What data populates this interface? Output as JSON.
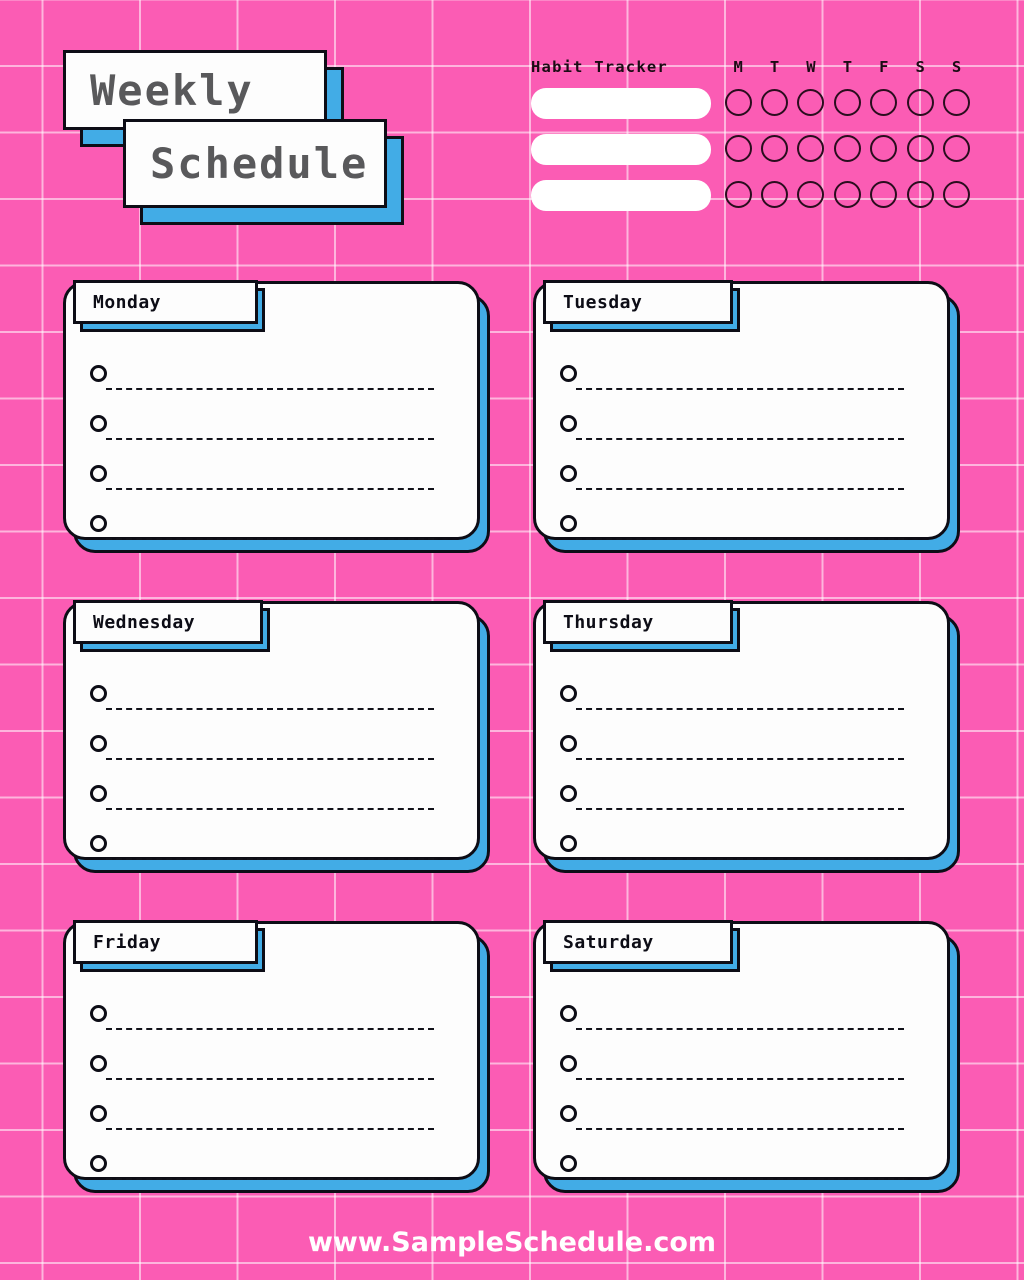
{
  "background": {
    "color": "#FB5CB4",
    "grid_line_color": "#FFFFFF"
  },
  "theme": {
    "pink": "#FB5CB4",
    "blue": "#42ACE6",
    "black": "#0D0D16",
    "white": "#FDFDFD",
    "title_gray": "#59595B"
  },
  "masthead": {
    "line1": "Weekly",
    "line2": "Schedule"
  },
  "habit_tracker": {
    "title": "Habit Tracker",
    "days": [
      "M",
      "T",
      "W",
      "T",
      "F",
      "S",
      "S"
    ],
    "rows": [
      {
        "habit_name": "",
        "placeholder": "",
        "checks": [
          false,
          false,
          false,
          false,
          false,
          false,
          false
        ]
      },
      {
        "habit_name": "",
        "placeholder": "",
        "checks": [
          false,
          false,
          false,
          false,
          false,
          false,
          false
        ]
      },
      {
        "habit_name": "",
        "placeholder": "",
        "checks": [
          false,
          false,
          false,
          false,
          false,
          false,
          false
        ]
      }
    ]
  },
  "days": [
    {
      "label": "Monday",
      "tasks": [
        {
          "done": false,
          "text": ""
        },
        {
          "done": false,
          "text": ""
        },
        {
          "done": false,
          "text": ""
        },
        {
          "done": false,
          "text": ""
        }
      ]
    },
    {
      "label": "Tuesday",
      "tasks": [
        {
          "done": false,
          "text": ""
        },
        {
          "done": false,
          "text": ""
        },
        {
          "done": false,
          "text": ""
        },
        {
          "done": false,
          "text": ""
        }
      ]
    },
    {
      "label": "Wednesday",
      "tasks": [
        {
          "done": false,
          "text": ""
        },
        {
          "done": false,
          "text": ""
        },
        {
          "done": false,
          "text": ""
        },
        {
          "done": false,
          "text": ""
        }
      ]
    },
    {
      "label": "Thursday",
      "tasks": [
        {
          "done": false,
          "text": ""
        },
        {
          "done": false,
          "text": ""
        },
        {
          "done": false,
          "text": ""
        },
        {
          "done": false,
          "text": ""
        }
      ]
    },
    {
      "label": "Friday",
      "tasks": [
        {
          "done": false,
          "text": ""
        },
        {
          "done": false,
          "text": ""
        },
        {
          "done": false,
          "text": ""
        },
        {
          "done": false,
          "text": ""
        }
      ]
    },
    {
      "label": "Saturday",
      "tasks": [
        {
          "done": false,
          "text": ""
        },
        {
          "done": false,
          "text": ""
        },
        {
          "done": false,
          "text": ""
        },
        {
          "done": false,
          "text": ""
        }
      ]
    }
  ],
  "footer": {
    "website": "www.SampleSchedule.com"
  }
}
